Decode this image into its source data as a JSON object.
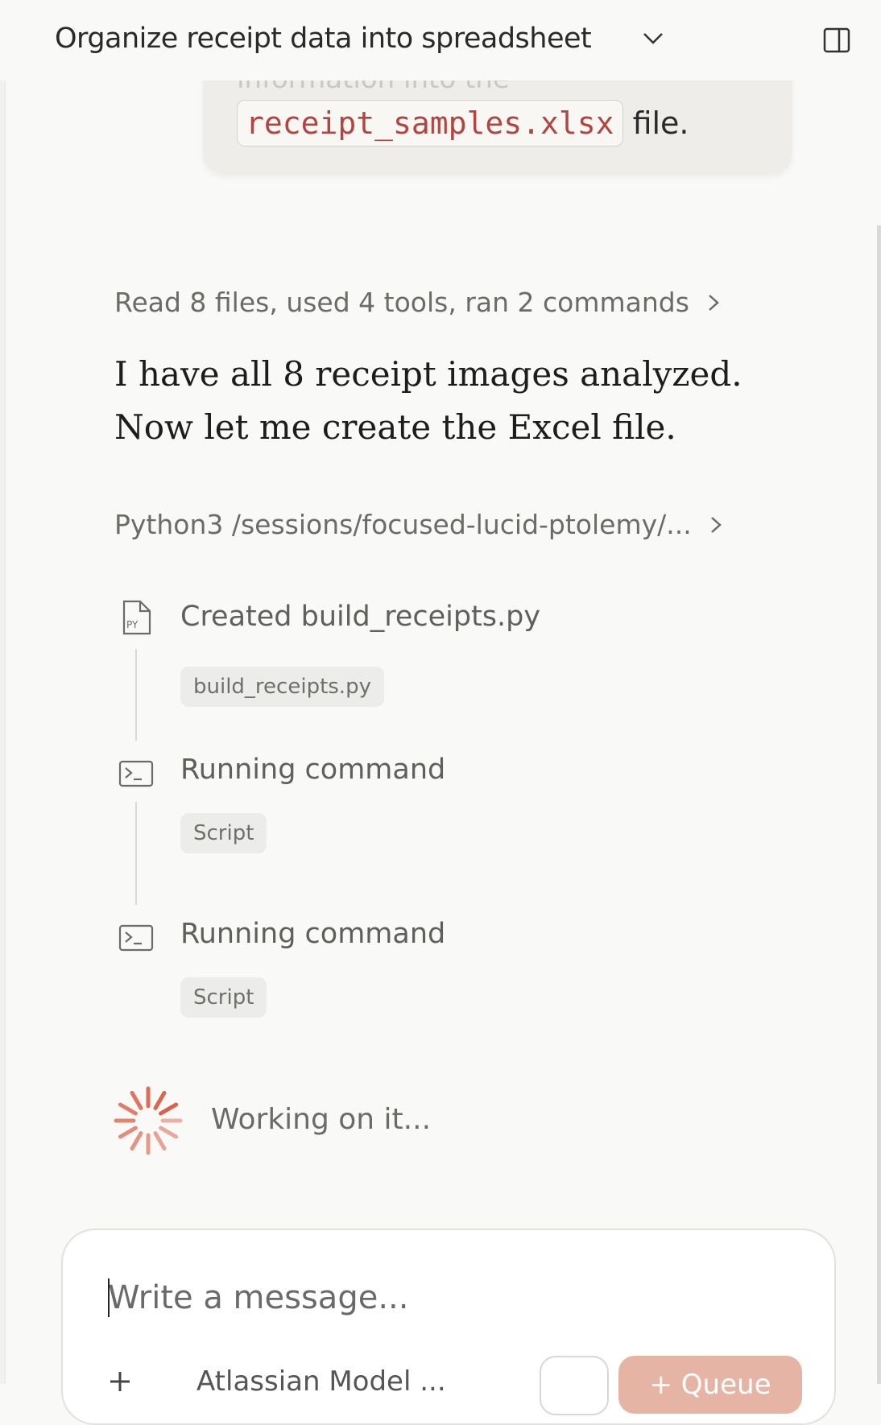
{
  "header": {
    "title": "Organize receipt data into spreadsheet",
    "title_chevron_icon": "chevron-down-icon",
    "panel_icon": "sidebar-panel-icon"
  },
  "user_message": {
    "faded_line": "information into the",
    "filename": "receipt_samples.xlsx",
    "suffix": "file."
  },
  "activity": {
    "summary": "Read 8 files, used 4 tools, ran 2 commands",
    "assistant_text": "I have all 8 receipt images analyzed. Now let me create the Excel file.",
    "command_path": "Python3 /sessions/focused-lucid-ptolemy/..."
  },
  "steps": [
    {
      "icon": "python-file-icon",
      "label": "Created build_receipts.py",
      "chip": "build_receipts.py"
    },
    {
      "icon": "terminal-icon",
      "label": "Running command",
      "chip": "Script"
    },
    {
      "icon": "terminal-icon",
      "label": "Running command",
      "chip": "Script"
    }
  ],
  "status": {
    "working_text": "Working on it...",
    "accent_color": "#d9593f"
  },
  "composer": {
    "placeholder": "Write a message...",
    "model_label": "Atlassian Model ...",
    "queue_label": "+ Queue"
  }
}
